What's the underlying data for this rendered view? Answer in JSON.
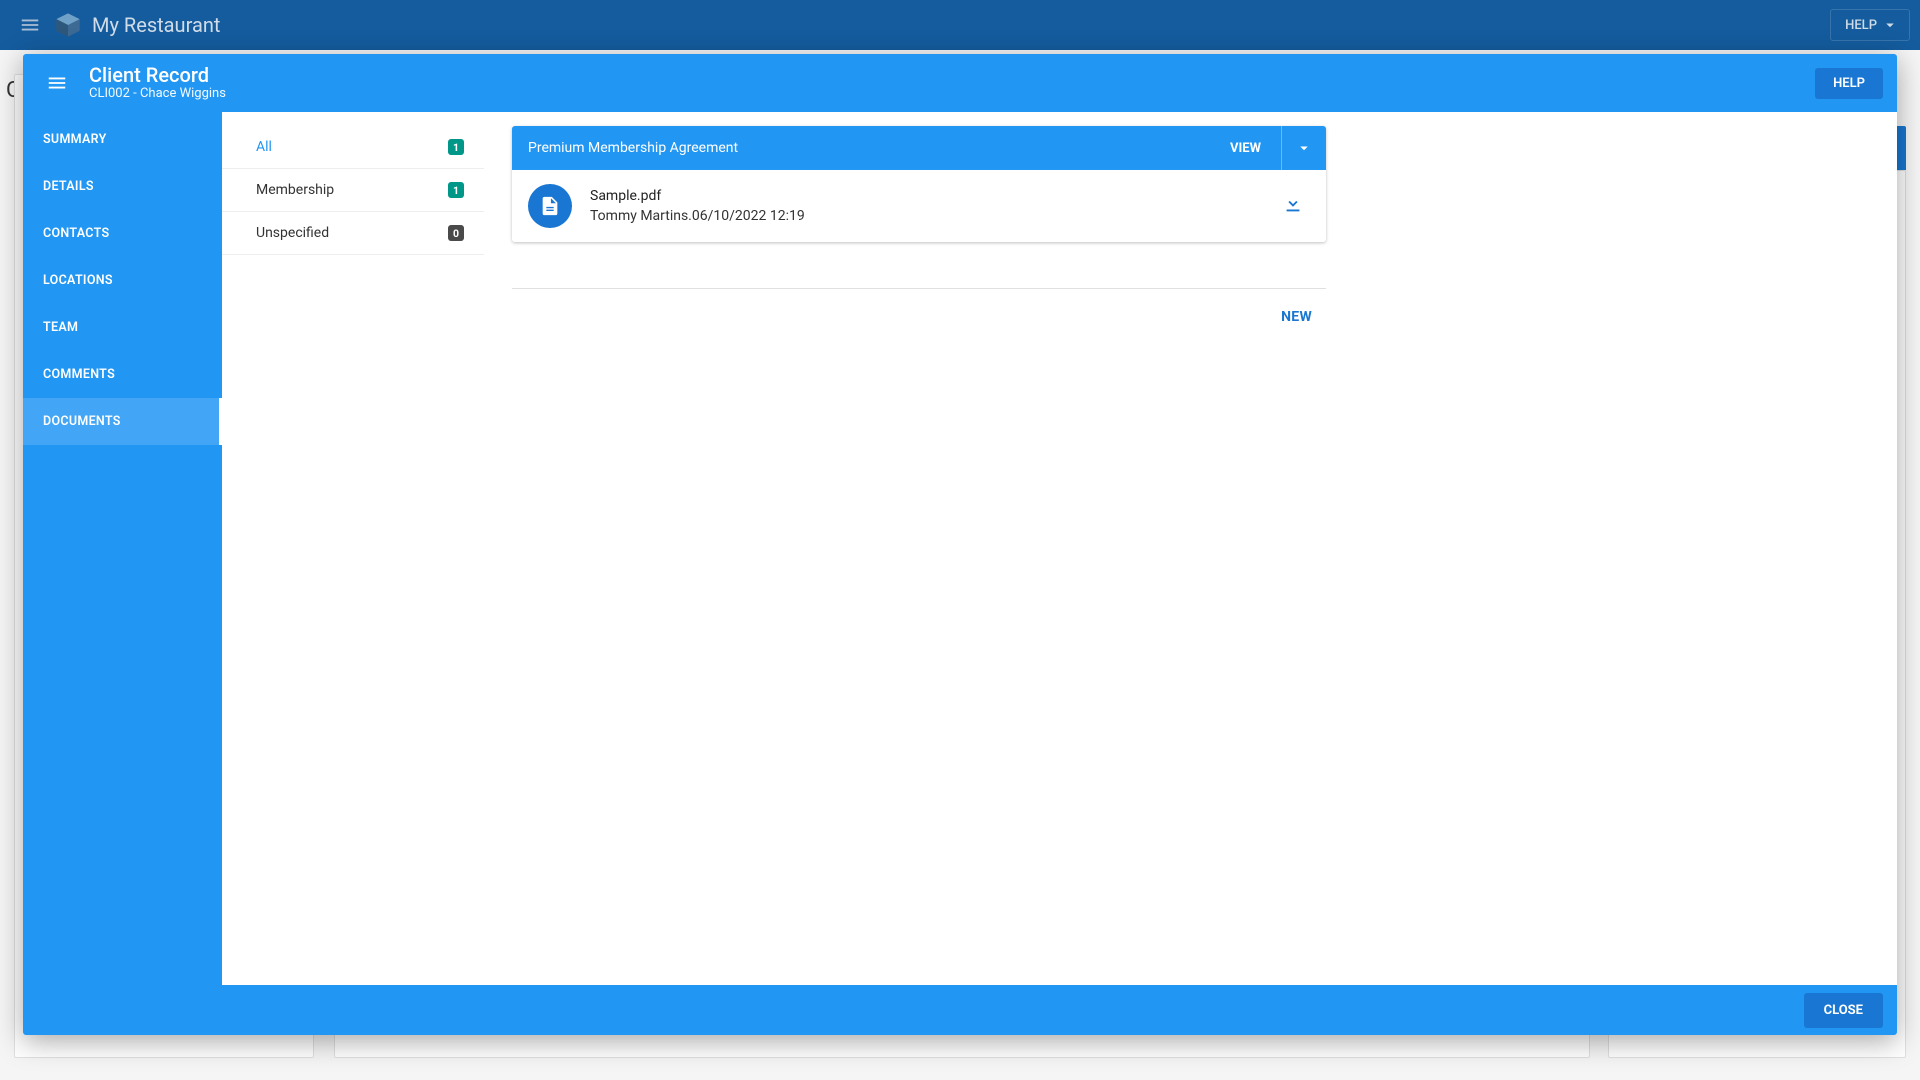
{
  "appbar": {
    "title": "My Restaurant",
    "help_label": "HELP"
  },
  "dialog": {
    "title": "Client Record",
    "subtitle": "CLI002 - Chace Wiggins",
    "help_label": "HELP",
    "close_label": "CLOSE"
  },
  "sidenav": {
    "items": [
      {
        "label": "SUMMARY"
      },
      {
        "label": "DETAILS"
      },
      {
        "label": "CONTACTS"
      },
      {
        "label": "LOCATIONS"
      },
      {
        "label": "TEAM"
      },
      {
        "label": "COMMENTS"
      },
      {
        "label": "DOCUMENTS"
      }
    ],
    "active_index": 6
  },
  "filters": {
    "items": [
      {
        "label": "All",
        "count": "1",
        "zero": false
      },
      {
        "label": "Membership",
        "count": "1",
        "zero": false
      },
      {
        "label": "Unspecified",
        "count": "0",
        "zero": true
      }
    ],
    "active_index": 0
  },
  "document": {
    "title": "Premium Membership Agreement",
    "view_label": "VIEW",
    "file_name": "Sample.pdf",
    "uploader": "Tommy Martins.",
    "uploaded_at": "06/10/2022 12:19",
    "new_label": "NEW"
  }
}
